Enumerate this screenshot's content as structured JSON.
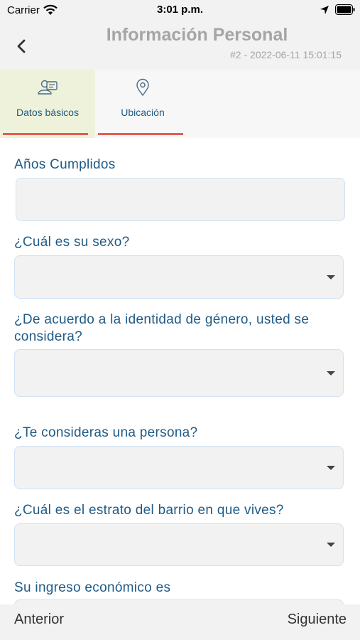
{
  "status_bar": {
    "carrier": "Carrier",
    "time": "3:01 p.m.",
    "icons": [
      "wifi-icon",
      "location-arrow-icon",
      "battery-icon"
    ]
  },
  "header": {
    "title": "Información Personal",
    "subtitle": "#2 - 2022-06-11 15:01:15",
    "back_icon": "chevron-left-icon"
  },
  "tabs": [
    {
      "label": "Datos básicos",
      "icon": "id-card-icon",
      "active": true
    },
    {
      "label": "Ubicación",
      "icon": "map-pin-icon",
      "active": false
    }
  ],
  "form": {
    "age_label": "Años Cumplidos",
    "age_value": "",
    "sex_label": "¿Cuál es su sexo?",
    "sex_value": "",
    "gender_label_line1": "¿De acuerdo a la identidad de género, usted se",
    "gender_label_line2": "considera?",
    "gender_value": "",
    "person_label": "¿Te consideras una persona?",
    "person_value": "",
    "stratum_label": "¿Cuál es el estrato del barrio en que vives?",
    "stratum_value": "",
    "income_label": "Su ingreso económico es"
  },
  "footer": {
    "prev_label": "Anterior",
    "next_label": "Siguiente"
  },
  "colors": {
    "label": "#1f5a86",
    "tab_active_bg": "#eef2da",
    "tab_underline": "#e25d52",
    "field_border": "#cfe1f3",
    "field_bg": "#f2f2f2"
  }
}
